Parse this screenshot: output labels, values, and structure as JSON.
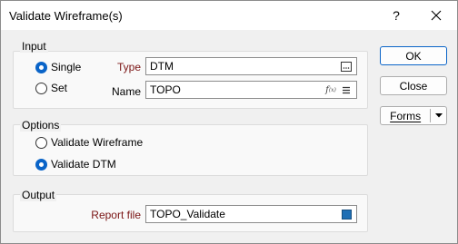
{
  "window": {
    "title": "Validate Wireframe(s)",
    "help_label": "?"
  },
  "input_group": {
    "label": "Input",
    "single_label": "Single",
    "set_label": "Set",
    "type_label": "Type",
    "type_value": "DTM",
    "name_label": "Name",
    "name_value": "TOPO"
  },
  "options_group": {
    "label": "Options",
    "validate_wireframe_label": "Validate Wireframe",
    "validate_dtm_label": "Validate DTM"
  },
  "output_group": {
    "label": "Output",
    "report_file_label": "Report file",
    "report_file_value": "TOPO_Validate"
  },
  "buttons": {
    "ok": "OK",
    "close": "Close",
    "forms": "Forms"
  },
  "colors": {
    "accent": "#0a64c8",
    "label_red": "#7a1414",
    "file_icon": "#1f6fb5"
  },
  "icons": {
    "browse": "ellipsis-icon",
    "function": "function-icon",
    "list": "list-icon",
    "file": "file-square-icon",
    "dropdown": "chevron-down-icon"
  }
}
